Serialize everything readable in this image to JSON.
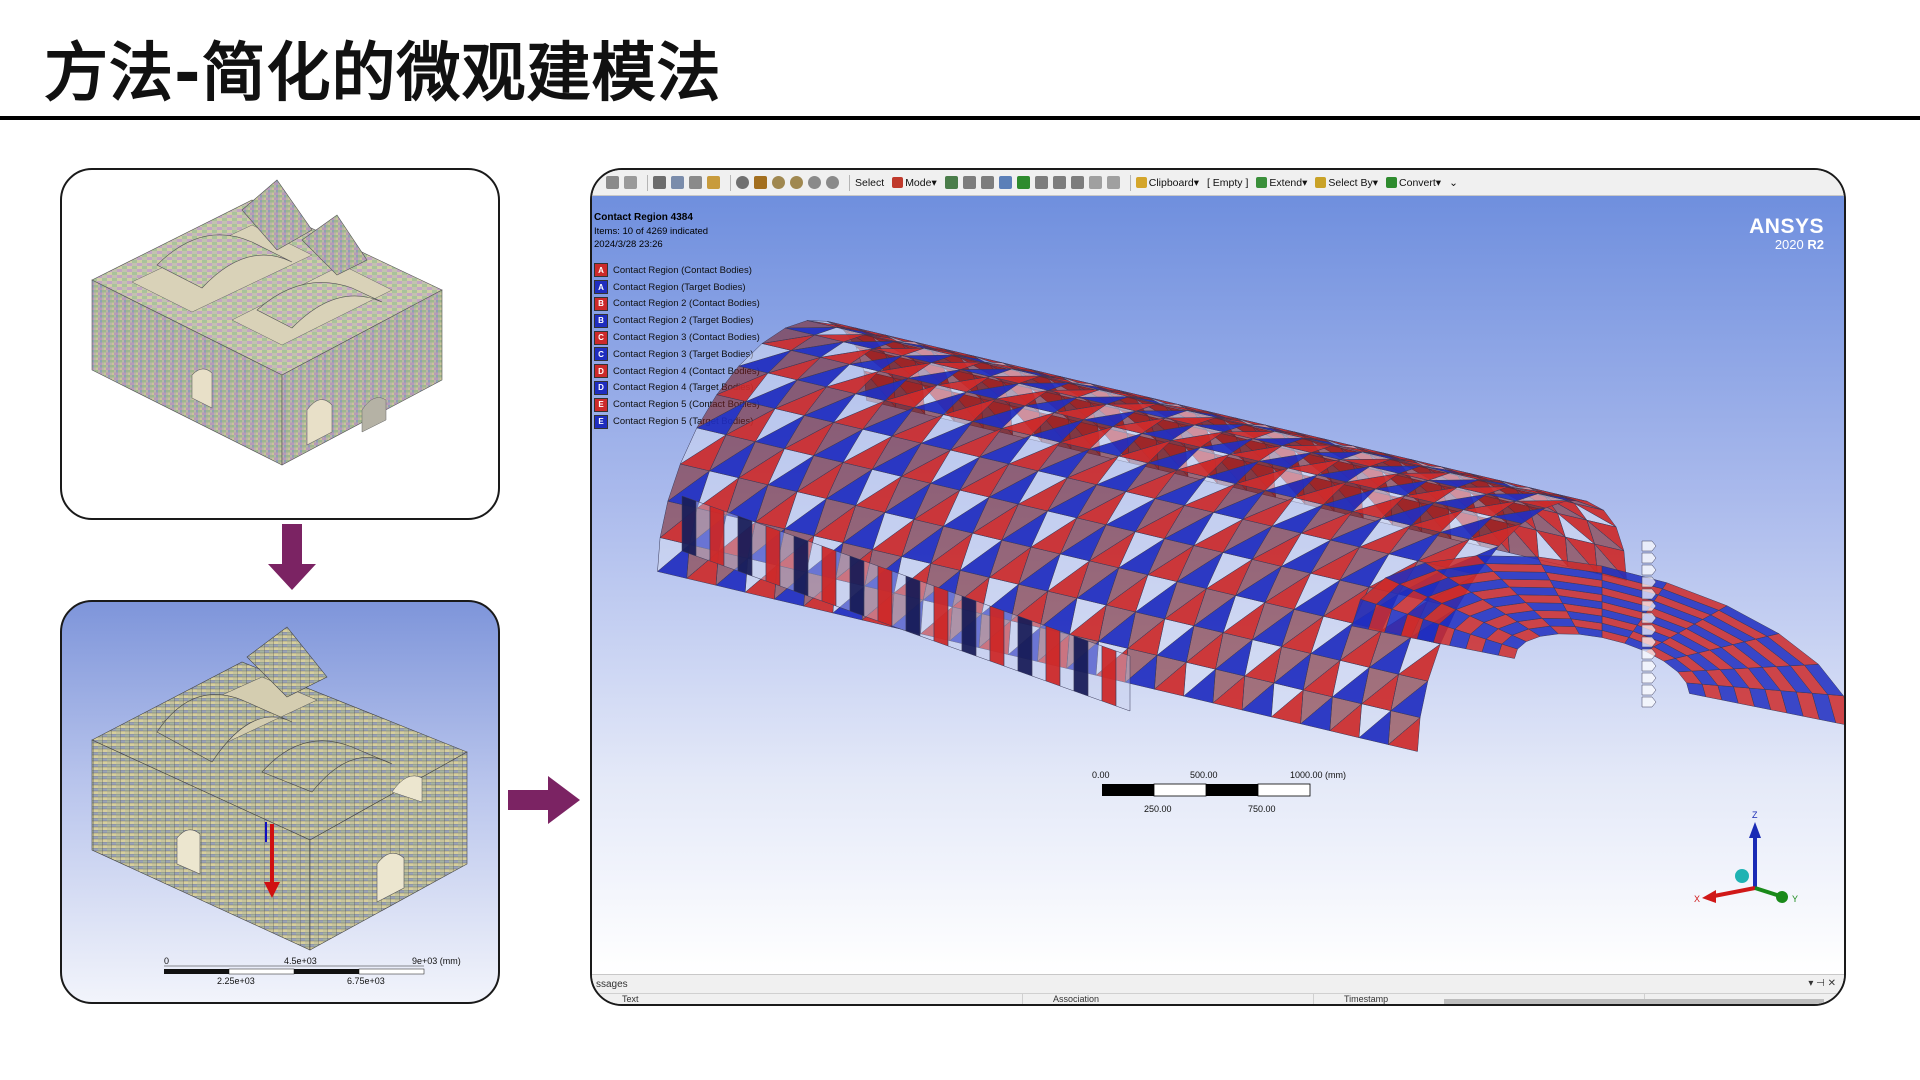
{
  "slide": {
    "title": "方法-简化的微观建模法"
  },
  "colors": {
    "accent_arrow": "#7b2363",
    "contact_red": "#cc2a2a",
    "target_blue": "#1f2dbf",
    "viewport_top": "#6f8fde"
  },
  "ansys": {
    "toolbar": {
      "select": "Select",
      "mode": "Mode",
      "clipboard": "Clipboard",
      "empty": "[ Empty ]",
      "extend": "Extend",
      "select_by": "Select By",
      "convert": "Convert"
    },
    "info": {
      "title": "Contact Region 4384",
      "items": "Items: 10 of 4269 indicated",
      "timestamp": "2024/3/28 23:26"
    },
    "legend": [
      {
        "letter": "A",
        "label": "Contact Region (Contact Bodies)",
        "kind": "contact"
      },
      {
        "letter": "A",
        "label": "Contact Region (Target Bodies)",
        "kind": "target"
      },
      {
        "letter": "B",
        "label": "Contact Region 2 (Contact Bodies)",
        "kind": "contact"
      },
      {
        "letter": "B",
        "label": "Contact Region 2 (Target Bodies)",
        "kind": "target"
      },
      {
        "letter": "C",
        "label": "Contact Region 3 (Contact Bodies)",
        "kind": "contact"
      },
      {
        "letter": "C",
        "label": "Contact Region 3 (Target Bodies)",
        "kind": "target"
      },
      {
        "letter": "D",
        "label": "Contact Region 4 (Contact Bodies)",
        "kind": "contact"
      },
      {
        "letter": "D",
        "label": "Contact Region 4 (Target Bodies)",
        "kind": "target"
      },
      {
        "letter": "E",
        "label": "Contact Region 5 (Contact Bodies)",
        "kind": "contact"
      },
      {
        "letter": "E",
        "label": "Contact Region 5 (Target Bodies)",
        "kind": "target"
      }
    ],
    "logo": {
      "brand": "ANSYS",
      "year": "2020",
      "release": "R2"
    },
    "scale": {
      "top_labels": [
        "0.00",
        "500.00",
        "1000.00 (mm)"
      ],
      "bottom_labels": [
        "250.00",
        "750.00"
      ]
    },
    "triad": {
      "z": "Z",
      "x": "X",
      "y": "Y"
    },
    "messages": {
      "label": "ssages",
      "col1": "Text",
      "col2": "Association",
      "col3": "Timestamp"
    }
  },
  "small_scale": {
    "top_labels": [
      "0",
      "4.5e+03",
      "9e+03 (mm)"
    ],
    "bottom_labels": [
      "2.25e+03",
      "6.75e+03"
    ]
  }
}
